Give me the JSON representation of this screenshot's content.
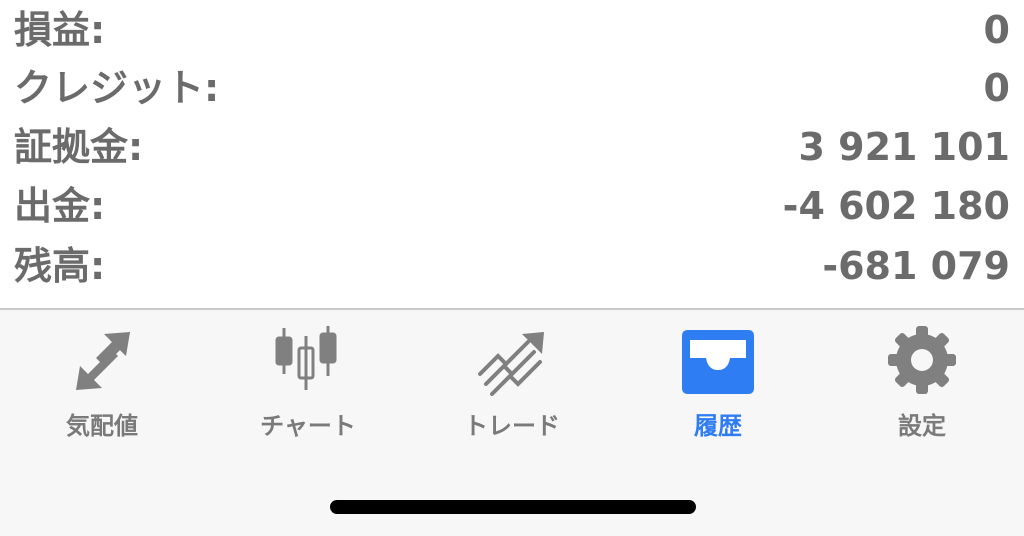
{
  "account_summary": {
    "rows": [
      {
        "label": "損益:",
        "value": "0"
      },
      {
        "label": "クレジット:",
        "value": "0"
      },
      {
        "label": "証拠金:",
        "value": "3 921 101"
      },
      {
        "label": "出金:",
        "value": "-4 602 180"
      },
      {
        "label": "残高:",
        "value": "-681 079"
      }
    ]
  },
  "tabbar": {
    "tabs": [
      {
        "label": "気配値",
        "icon": "quotes-arrows-icon",
        "active": false
      },
      {
        "label": "チャート",
        "icon": "candlestick-icon",
        "active": false
      },
      {
        "label": "トレード",
        "icon": "trade-trend-icon",
        "active": false
      },
      {
        "label": "履歴",
        "icon": "history-tray-icon",
        "active": true
      },
      {
        "label": "設定",
        "icon": "gear-icon",
        "active": false
      }
    ]
  },
  "colors": {
    "text_gray": "#6b6b6b",
    "icon_gray": "#808080",
    "active_blue": "#2f7df2",
    "tabbar_bg": "#f7f7f7"
  }
}
